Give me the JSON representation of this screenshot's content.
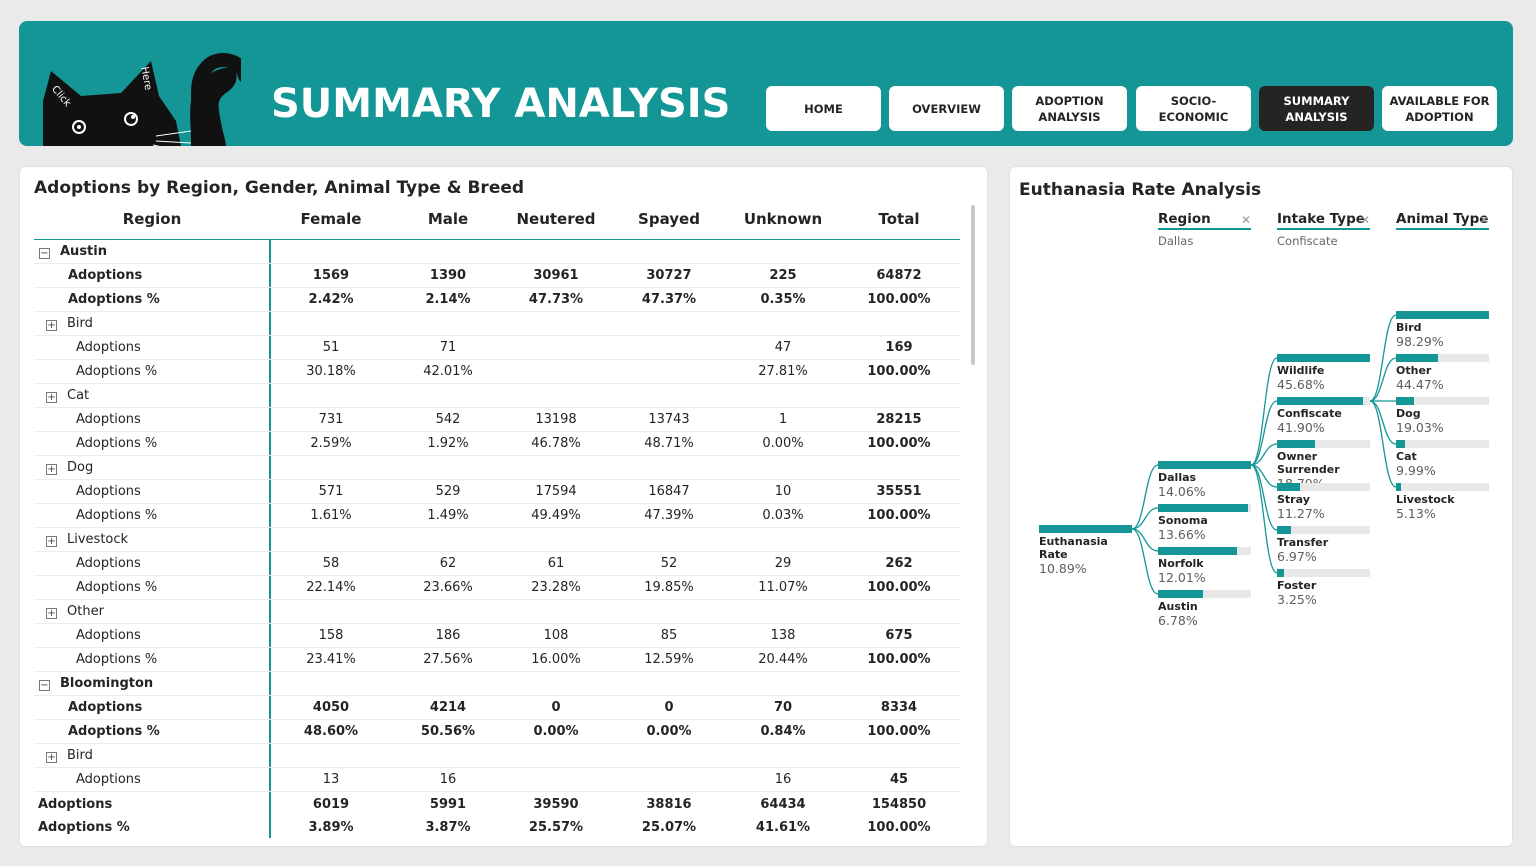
{
  "header": {
    "title": "SUMMARY ANALYSIS",
    "cat_text": [
      "Click",
      "Here"
    ],
    "nav": [
      {
        "label": "HOME",
        "active": false
      },
      {
        "label": "OVERVIEW",
        "active": false
      },
      {
        "label": "ADOPTION\nANALYSIS",
        "active": false
      },
      {
        "label": "SOCIO-\nECONOMIC",
        "active": false
      },
      {
        "label": "SUMMARY\nANALYSIS",
        "active": true
      },
      {
        "label": "AVAILABLE FOR\nADOPTION",
        "active": false
      }
    ]
  },
  "matrix": {
    "title": "Adoptions by Region, Gender, Animal Type & Breed",
    "columns": [
      "Region",
      "Female",
      "Male",
      "Neutered",
      "Spayed",
      "Unknown",
      "Total"
    ],
    "rows": [
      {
        "level": 0,
        "label": "Austin",
        "expand": "−",
        "values": [
          "",
          "",
          "",
          "",
          "",
          ""
        ]
      },
      {
        "level": 1,
        "label": "Adoptions",
        "bold": true,
        "values": [
          "1569",
          "1390",
          "30961",
          "30727",
          "225",
          "64872"
        ]
      },
      {
        "level": 1,
        "label": "Adoptions %",
        "bold": true,
        "values": [
          "2.42%",
          "2.14%",
          "47.73%",
          "47.37%",
          "0.35%",
          "100.00%"
        ]
      },
      {
        "level": 2,
        "label": "Bird",
        "expand": "+",
        "values": [
          "",
          "",
          "",
          "",
          "",
          ""
        ]
      },
      {
        "level": 3,
        "label": "Adoptions",
        "values": [
          "51",
          "71",
          "",
          "",
          "47",
          "169"
        ]
      },
      {
        "level": 3,
        "label": "Adoptions %",
        "values": [
          "30.18%",
          "42.01%",
          "",
          "",
          "27.81%",
          "100.00%"
        ]
      },
      {
        "level": 2,
        "label": "Cat",
        "expand": "+",
        "values": [
          "",
          "",
          "",
          "",
          "",
          ""
        ]
      },
      {
        "level": 3,
        "label": "Adoptions",
        "values": [
          "731",
          "542",
          "13198",
          "13743",
          "1",
          "28215"
        ]
      },
      {
        "level": 3,
        "label": "Adoptions %",
        "values": [
          "2.59%",
          "1.92%",
          "46.78%",
          "48.71%",
          "0.00%",
          "100.00%"
        ]
      },
      {
        "level": 2,
        "label": "Dog",
        "expand": "+",
        "values": [
          "",
          "",
          "",
          "",
          "",
          ""
        ]
      },
      {
        "level": 3,
        "label": "Adoptions",
        "values": [
          "571",
          "529",
          "17594",
          "16847",
          "10",
          "35551"
        ]
      },
      {
        "level": 3,
        "label": "Adoptions %",
        "values": [
          "1.61%",
          "1.49%",
          "49.49%",
          "47.39%",
          "0.03%",
          "100.00%"
        ]
      },
      {
        "level": 2,
        "label": "Livestock",
        "expand": "+",
        "values": [
          "",
          "",
          "",
          "",
          "",
          ""
        ]
      },
      {
        "level": 3,
        "label": "Adoptions",
        "values": [
          "58",
          "62",
          "61",
          "52",
          "29",
          "262"
        ]
      },
      {
        "level": 3,
        "label": "Adoptions %",
        "values": [
          "22.14%",
          "23.66%",
          "23.28%",
          "19.85%",
          "11.07%",
          "100.00%"
        ]
      },
      {
        "level": 2,
        "label": "Other",
        "expand": "+",
        "values": [
          "",
          "",
          "",
          "",
          "",
          ""
        ]
      },
      {
        "level": 3,
        "label": "Adoptions",
        "values": [
          "158",
          "186",
          "108",
          "85",
          "138",
          "675"
        ]
      },
      {
        "level": 3,
        "label": "Adoptions %",
        "values": [
          "23.41%",
          "27.56%",
          "16.00%",
          "12.59%",
          "20.44%",
          "100.00%"
        ]
      },
      {
        "level": 0,
        "label": "Bloomington",
        "expand": "−",
        "values": [
          "",
          "",
          "",
          "",
          "",
          ""
        ]
      },
      {
        "level": 1,
        "label": "Adoptions",
        "bold": true,
        "values": [
          "4050",
          "4214",
          "0",
          "0",
          "70",
          "8334"
        ]
      },
      {
        "level": 1,
        "label": "Adoptions %",
        "bold": true,
        "values": [
          "48.60%",
          "50.56%",
          "0.00%",
          "0.00%",
          "0.84%",
          "100.00%"
        ]
      },
      {
        "level": 2,
        "label": "Bird",
        "expand": "+",
        "values": [
          "",
          "",
          "",
          "",
          "",
          ""
        ]
      },
      {
        "level": 3,
        "label": "Adoptions",
        "values": [
          "13",
          "16",
          "",
          "",
          "16",
          "45"
        ]
      }
    ],
    "totals": [
      {
        "label": "Adoptions",
        "values": [
          "6019",
          "5991",
          "39590",
          "38816",
          "64434",
          "154850"
        ]
      },
      {
        "label": "Adoptions %",
        "values": [
          "3.89%",
          "3.87%",
          "25.57%",
          "25.07%",
          "41.61%",
          "100.00%"
        ]
      }
    ]
  },
  "tree": {
    "title": "Euthanasia Rate Analysis",
    "levels": [
      {
        "name": "Region",
        "selected": "Dallas"
      },
      {
        "name": "Intake Type",
        "selected": "Confiscate"
      },
      {
        "name": "Animal Type",
        "selected": ""
      }
    ],
    "root": {
      "label": "Euthanasia Rate",
      "value": "10.89%",
      "fraction": 1.0
    },
    "region": [
      {
        "label": "Dallas",
        "value": "14.06%",
        "fraction": 1.0
      },
      {
        "label": "Sonoma",
        "value": "13.66%",
        "fraction": 0.97
      },
      {
        "label": "Norfolk",
        "value": "12.01%",
        "fraction": 0.85
      },
      {
        "label": "Austin",
        "value": "6.78%",
        "fraction": 0.48
      }
    ],
    "intake": [
      {
        "label": "Wildlife",
        "value": "45.68%",
        "fraction": 1.0
      },
      {
        "label": "Confiscate",
        "value": "41.90%",
        "fraction": 0.92
      },
      {
        "label": "Owner Surrender",
        "value": "18.79%",
        "fraction": 0.41
      },
      {
        "label": "Stray",
        "value": "11.27%",
        "fraction": 0.25
      },
      {
        "label": "Transfer",
        "value": "6.97%",
        "fraction": 0.15
      },
      {
        "label": "Foster",
        "value": "3.25%",
        "fraction": 0.07
      }
    ],
    "animal": [
      {
        "label": "Bird",
        "value": "98.29%",
        "fraction": 1.0
      },
      {
        "label": "Other",
        "value": "44.47%",
        "fraction": 0.45
      },
      {
        "label": "Dog",
        "value": "19.03%",
        "fraction": 0.19
      },
      {
        "label": "Cat",
        "value": "9.99%",
        "fraction": 0.1
      },
      {
        "label": "Livestock",
        "value": "5.13%",
        "fraction": 0.05
      }
    ],
    "colors": {
      "accent": "#149696",
      "track": "#e8e8e8"
    }
  }
}
